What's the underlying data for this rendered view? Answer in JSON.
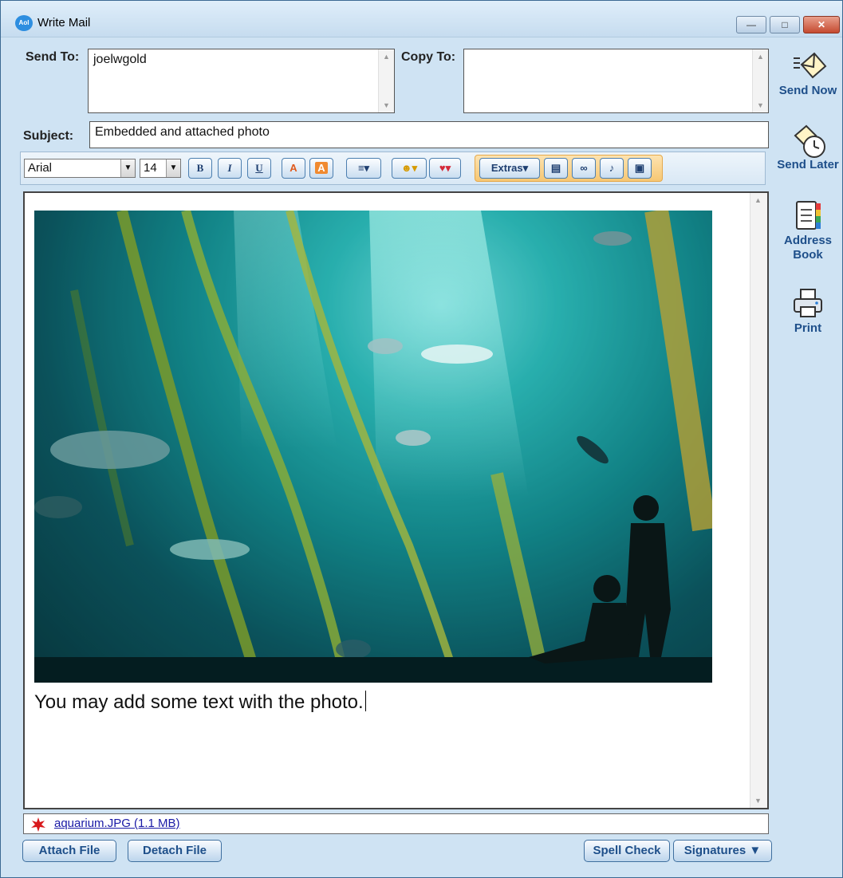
{
  "window": {
    "title": "Write Mail",
    "app_icon_text": "Aol"
  },
  "fields": {
    "send_to_label": "Send To:",
    "send_to_value": "joelwgold",
    "copy_to_label": "Copy To:",
    "copy_to_value": "",
    "subject_label": "Subject:",
    "subject_value": "Embedded and attached photo"
  },
  "toolbar": {
    "font": "Arial",
    "size": "14",
    "bold": "B",
    "italic": "I",
    "underline": "U",
    "extras": "Extras▾"
  },
  "side_actions": {
    "send_now": "Send Now",
    "send_later": "Send Later",
    "address_book": "Address Book",
    "print": "Print"
  },
  "editor": {
    "body_text": "You may add some text with the photo."
  },
  "attachments": {
    "file": "aquarium.JPG (1.1 MB)"
  },
  "bottom_buttons": {
    "attach": "Attach File",
    "detach": "Detach File",
    "spell_check": "Spell Check",
    "signatures": "Signatures ▼"
  },
  "colors": {
    "window_bg": "#cfe3f3",
    "label_blue": "#1e4f8a",
    "extras_orange": "#f6c774",
    "close_red": "#c54a30"
  }
}
